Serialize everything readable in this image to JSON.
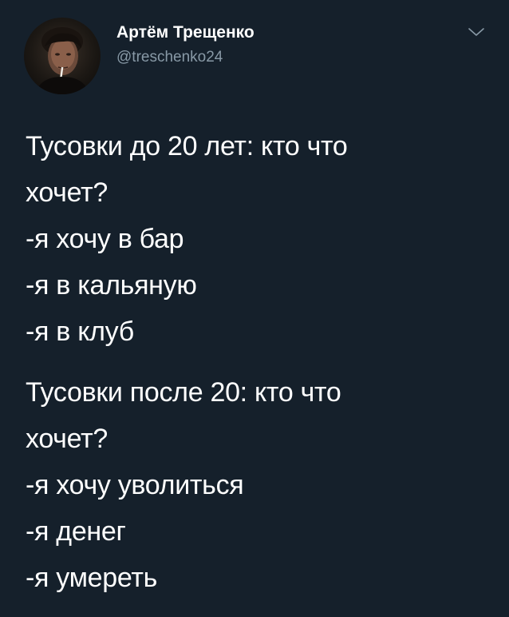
{
  "author": {
    "display_name": "Артём Трещенко",
    "handle": "@treschenko24",
    "avatar_icon": "profile-photo"
  },
  "menu": {
    "icon": "chevron-down-icon"
  },
  "tweet": {
    "paragraphs": [
      {
        "lines": [
          "Тусовки до 20 лет: кто что",
          "хочет?",
          "-я хочу в бар",
          "-я в кальяную",
          "-я в клуб"
        ]
      },
      {
        "lines": [
          "Тусовки после 20: кто что",
          "хочет?",
          "-я хочу уволиться",
          "-я денег",
          "-я умереть"
        ]
      }
    ]
  },
  "colors": {
    "background": "#15202b",
    "text_primary": "#ffffff",
    "text_secondary": "#8899a6"
  }
}
